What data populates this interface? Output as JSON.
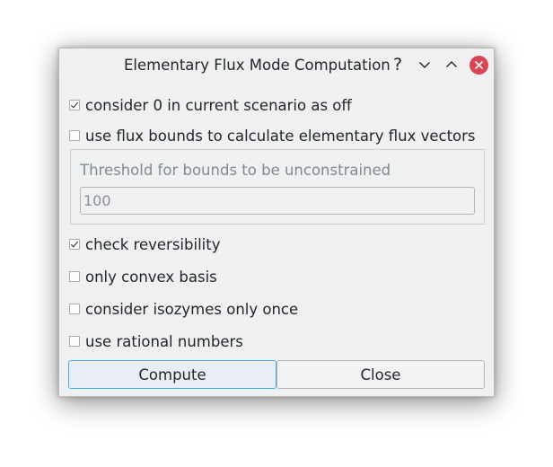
{
  "dialog": {
    "title": "Elementary Flux Mode Computation",
    "help_glyph": "?"
  },
  "options": {
    "consider_zero": {
      "label": "consider 0 in current scenario as off",
      "checked": true
    },
    "use_flux_bounds": {
      "label": "use flux bounds to calculate elementary flux vectors",
      "checked": false
    },
    "check_reversibility": {
      "label": "check reversibility",
      "checked": true
    },
    "only_convex_basis": {
      "label": "only convex basis",
      "checked": false
    },
    "isozymes_once": {
      "label": "consider isozymes only once",
      "checked": false
    },
    "rational_numbers": {
      "label": "use rational numbers",
      "checked": false
    }
  },
  "bounds_group": {
    "label": "Threshold for bounds to be unconstrained",
    "value": "100"
  },
  "buttons": {
    "compute": "Compute",
    "close": "Close"
  },
  "colors": {
    "background": "#eff0f1",
    "accent": "#3daee9",
    "close_button": "#da4453"
  },
  "icons": {
    "help": "help-icon",
    "minimize": "chevron-down-icon",
    "maximize": "chevron-up-icon",
    "close": "close-icon"
  }
}
